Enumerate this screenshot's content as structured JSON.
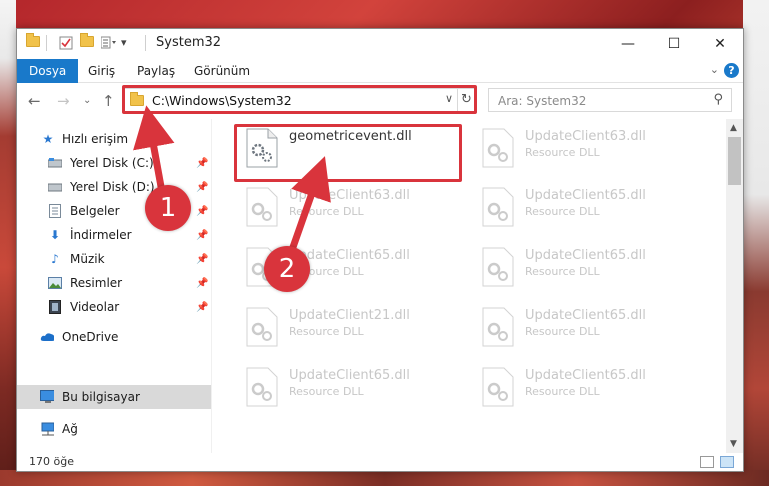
{
  "window": {
    "title": "System32",
    "minimize_glyph": "—",
    "maximize_glyph": "☐",
    "close_glyph": "✕"
  },
  "ribbon": {
    "tabs": [
      {
        "label": "Dosya",
        "active": true
      },
      {
        "label": "Giriş"
      },
      {
        "label": "Paylaş"
      },
      {
        "label": "Görünüm"
      }
    ],
    "help_glyph": "?",
    "collapse_glyph": "⌄"
  },
  "address": {
    "path": "C:\\Windows\\System32",
    "dropdown_glyph": "∨",
    "refresh_glyph": "↻"
  },
  "search": {
    "placeholder": "Ara: System32",
    "icon": "search-icon"
  },
  "sidebar": {
    "items": [
      {
        "label": "Hızlı erişim",
        "icon": "star-icon",
        "pinned": false
      },
      {
        "label": "Yerel Disk (C:)",
        "icon": "drive-icon",
        "pinned": true
      },
      {
        "label": "Yerel Disk (D:)",
        "icon": "drive-icon",
        "pinned": true
      },
      {
        "label": "Belgeler",
        "icon": "documents-icon",
        "pinned": true
      },
      {
        "label": "İndirmeler",
        "icon": "download-icon",
        "pinned": true
      },
      {
        "label": "Müzik",
        "icon": "music-icon",
        "pinned": true
      },
      {
        "label": "Resimler",
        "icon": "pictures-icon",
        "pinned": true
      },
      {
        "label": "Videolar",
        "icon": "videos-icon",
        "pinned": true
      },
      {
        "label": "OneDrive",
        "icon": "cloud-icon",
        "pinned": false
      },
      {
        "label": "Bu bilgisayar",
        "icon": "computer-icon",
        "pinned": false,
        "selected": true
      },
      {
        "label": "Ağ",
        "icon": "network-icon",
        "pinned": false
      }
    ]
  },
  "files": [
    {
      "name": "geometricevent.dll",
      "type": "",
      "highlighted": true
    },
    {
      "name": "UpdateClient63.dll",
      "type": "Resource DLL"
    },
    {
      "name": "UpdateClient63.dll",
      "type": "Resource DLL"
    },
    {
      "name": "UpdateClient65.dll",
      "type": "Resource DLL"
    },
    {
      "name": "UpdateClient65.dll",
      "type": "Resource DLL"
    },
    {
      "name": "UpdateClient65.dll",
      "type": "Resource DLL"
    },
    {
      "name": "UpdateClient21.dll",
      "type": "Resource DLL"
    },
    {
      "name": "UpdateClient65.dll",
      "type": "Resource DLL"
    },
    {
      "name": "UpdateClient65.dll",
      "type": "Resource DLL"
    },
    {
      "name": "UpdateClient65.dll",
      "type": "Resource DLL"
    }
  ],
  "status": {
    "item_count": "170 öğe"
  },
  "callouts": [
    {
      "number": "1"
    },
    {
      "number": "2"
    }
  ],
  "colors": {
    "accent": "#1979ca",
    "highlight": "#d9343c",
    "selected_nav": "#d9d9d9"
  }
}
